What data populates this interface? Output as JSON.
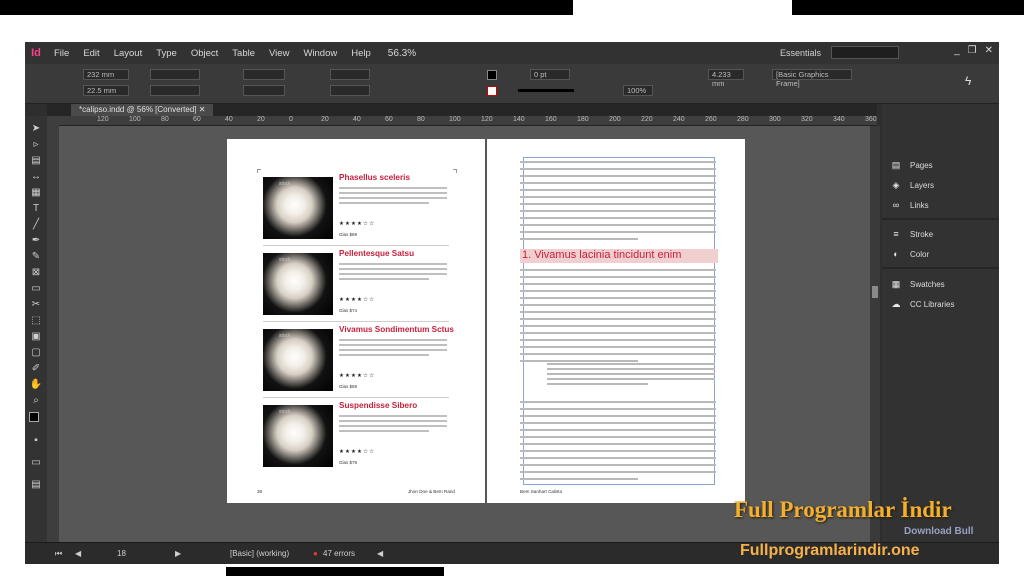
{
  "window": {
    "logo": "Id",
    "menu": [
      "File",
      "Edit",
      "Layout",
      "Type",
      "Object",
      "Table",
      "View",
      "Window",
      "Help"
    ],
    "zoom": "56.3%",
    "workspace": "Essentials",
    "controls": [
      "_",
      "❐",
      "✕"
    ]
  },
  "control": {
    "x": "232 mm",
    "y": "22.5 mm",
    "stroke_weight": "0 pt",
    "opacity": "100%",
    "dim": "4.233 mm",
    "frame_style": "[Basic Graphics Frame]"
  },
  "tab": {
    "title": "*calipso.indd @ 56% [Converted]"
  },
  "ruler": [
    "120",
    "100",
    "80",
    "60",
    "40",
    "20",
    "0",
    "20",
    "40",
    "60",
    "80",
    "100",
    "120",
    "140",
    "160",
    "180",
    "200",
    "220",
    "240",
    "260",
    "280",
    "300",
    "320",
    "340",
    "360"
  ],
  "panels": [
    {
      "icon": "pages-icon",
      "label": "Pages"
    },
    {
      "icon": "layers-icon",
      "label": "Layers"
    },
    {
      "icon": "links-icon",
      "label": "Links"
    },
    {
      "icon": "stroke-icon",
      "label": "Stroke"
    },
    {
      "icon": "color-icon",
      "label": "Color"
    },
    {
      "icon": "swatches-icon",
      "label": "Swatches"
    },
    {
      "icon": "cc-libraries-icon",
      "label": "CC Libraries"
    }
  ],
  "status": {
    "page": "18",
    "style": "[Basic] (working)",
    "errors": "47 errors"
  },
  "left_page": {
    "items": [
      {
        "title": "Phasellus sceleris",
        "price": "Glas $69",
        "stars": "★★★★☆☆"
      },
      {
        "title": "Pellentesque Satsu",
        "price": "Glas $74",
        "stars": "★★★★☆☆"
      },
      {
        "title": "Vivamus Sondimentum Sctus",
        "price": "Glas $59",
        "stars": "★★★★☆☆"
      },
      {
        "title": "Suspendisse Sibero",
        "price": "Glas $79",
        "stars": "★★★★☆☆"
      }
    ],
    "watermark": "stock",
    "footer_left": "38",
    "footer_right": "Jhon Doe & Bem Rand"
  },
  "right_page": {
    "heading": "1. Vivamus lacinia tincidunt enim",
    "footer": "Bem Sanhart Calisto"
  },
  "watermark": {
    "line1": "Full Programlar İndir",
    "line2": "Fullprogramlarindir.one",
    "line3": "Download Bull"
  }
}
